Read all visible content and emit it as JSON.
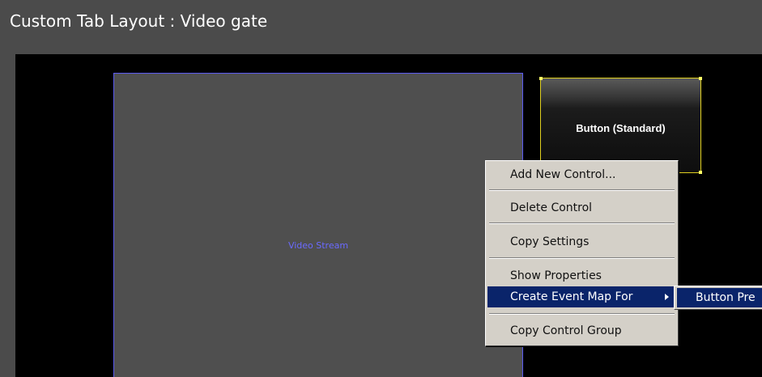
{
  "window": {
    "title": "Custom Tab Layout : Video gate"
  },
  "canvas": {
    "video_stream_label": "Video Stream",
    "button_label": "Button (Standard)"
  },
  "context_menu": {
    "items": [
      {
        "label": "Add New Control..."
      },
      {
        "label": "Delete Control"
      },
      {
        "label": "Copy Settings"
      },
      {
        "label": "Show Properties"
      },
      {
        "label": "Create Event Map For",
        "highlighted": true,
        "has_submenu": true
      },
      {
        "label": "Copy Control Group"
      }
    ]
  },
  "submenu": {
    "items": [
      {
        "label": "Button Pre"
      }
    ]
  },
  "colors": {
    "window_bg": "#4b4b4b",
    "canvas_bg": "#000000",
    "video_bg": "#4f4f4f",
    "video_border": "#5a5af0",
    "button_selection_border": "#e0d020",
    "menu_bg": "#d4d0c8",
    "menu_highlight": "#0a246a"
  }
}
